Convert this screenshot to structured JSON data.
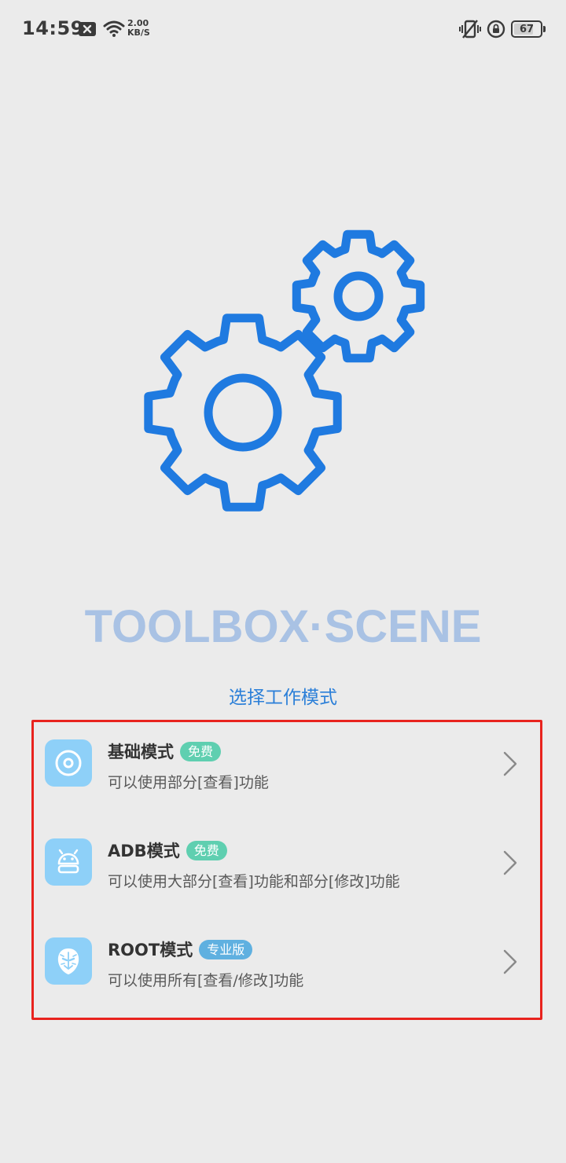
{
  "status_bar": {
    "time": "14:59",
    "net_speed_value": "2.00",
    "net_speed_unit": "KB/S",
    "battery": "67",
    "icons": [
      "close-box-icon",
      "wifi-icon",
      "vibrate-icon",
      "rotation-lock-icon",
      "battery-icon"
    ]
  },
  "hero": {
    "icon": "gears-icon",
    "brand": "TOOLBOX·SCENE",
    "subtitle": "选择工作模式"
  },
  "modes": [
    {
      "title": "基础模式",
      "badge": "免费",
      "badge_color": "#5fcfb0",
      "description": "可以使用部分[查看]功能",
      "icon": "disc-icon"
    },
    {
      "title": "ADB模式",
      "badge": "免费",
      "badge_color": "#5fcfb0",
      "description": "可以使用大部分[查看]功能和部分[修改]功能",
      "icon": "android-icon"
    },
    {
      "title": "ROOT模式",
      "badge": "专业版",
      "badge_color": "#5fb0e0",
      "description": "可以使用所有[查看/修改]功能",
      "icon": "mask-icon"
    }
  ],
  "colors": {
    "accent": "#2b7fd8",
    "gear": "#1f7ae0",
    "brand_text": "#a9c2e4",
    "icon_bg": "#8ed0f8",
    "highlight_border": "#e8231e",
    "background": "#ebebeb"
  }
}
